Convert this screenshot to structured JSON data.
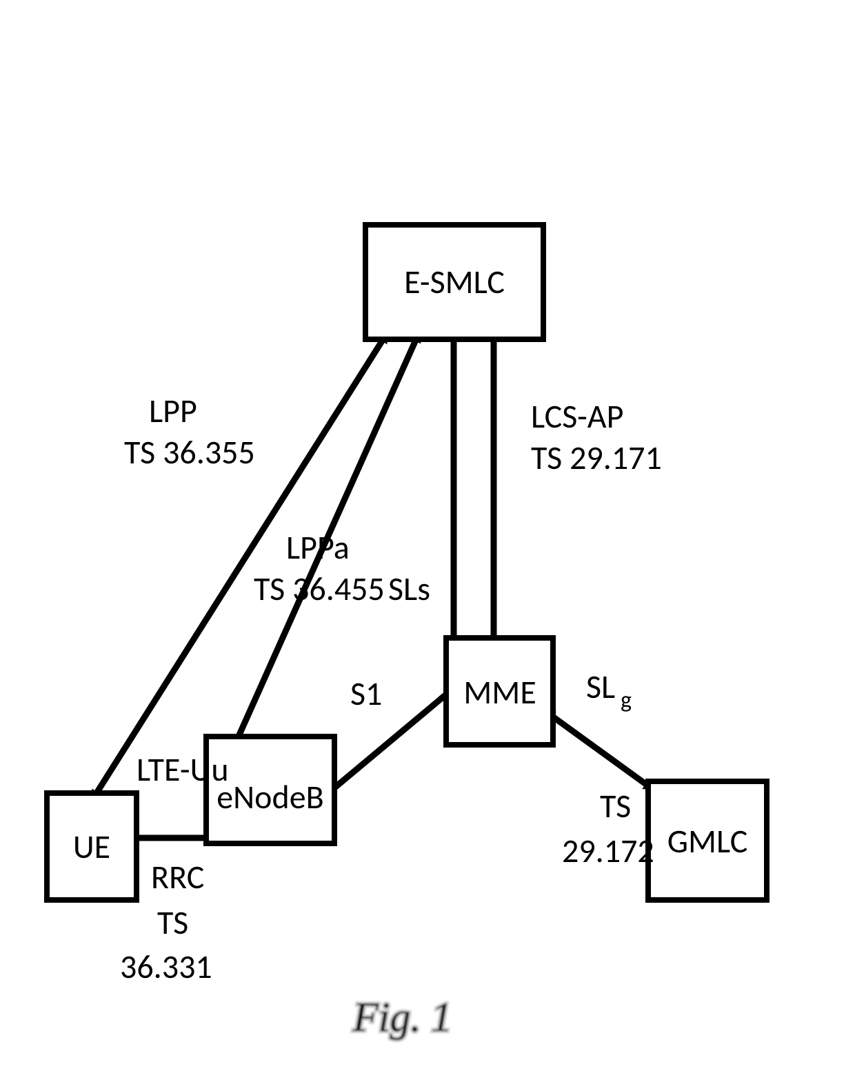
{
  "figure_caption": "Fig. 1",
  "nodes": {
    "esmlc": "E-SMLC",
    "ue": "UE",
    "enodeb": "eNodeB",
    "mme": "MME",
    "gmlc": "GMLC"
  },
  "interfaces": {
    "lte_uu": "LTE-Uu",
    "s1": "S1",
    "sls": "SLs",
    "slg": "SL",
    "slg_sub": "g"
  },
  "protocols": {
    "lpp": "LPP",
    "lpp_spec": "TS 36.355",
    "lppa": "LPPa",
    "lppa_spec": "TS 36.455",
    "lcs_ap": "LCS-AP",
    "lcs_ap_spec": "TS 29.171",
    "rrc": "RRC",
    "rrc_spec_a": "TS",
    "rrc_spec_b": "36.331",
    "slg_spec_a": "TS",
    "slg_spec_b": "29.172"
  }
}
